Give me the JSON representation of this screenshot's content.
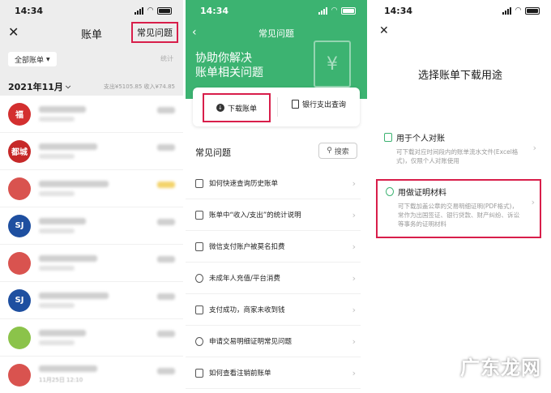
{
  "status": {
    "time": "14:34"
  },
  "bills": {
    "title": "账单",
    "faq_button": "常见问题",
    "filter_label": "全部账单",
    "stats_label": "统计",
    "month": "2021年11月",
    "totals": "支出¥5105.85  收入¥74.85",
    "last_date": "11月25日 12:10",
    "rows": [
      {
        "avatar_text": "福",
        "color": "#d32f2f"
      },
      {
        "avatar_text": "都城",
        "color": "#c62828"
      },
      {
        "avatar_text": "",
        "color": "#d9534f"
      },
      {
        "avatar_text": "SJ",
        "color": "#1e4fa0"
      },
      {
        "avatar_text": "",
        "color": "#d9534f"
      },
      {
        "avatar_text": "SJ",
        "color": "#1e4fa0"
      },
      {
        "avatar_text": "",
        "color": "#8bc34a"
      },
      {
        "avatar_text": "",
        "color": "#d9534f"
      }
    ]
  },
  "faq_page": {
    "nav_title": "常见问题",
    "headline_line1": "协助你解决",
    "headline_line2": "账单相关问题",
    "download_label": "下载账单",
    "bank_label": "银行支出查询",
    "section_title": "常见问题",
    "search_label": "搜索",
    "items": [
      "如何快速查询历史账单",
      "账单中“收入/支出”的统计说明",
      "微信支付账户被莫名扣费",
      "未成年人充值/平台消费",
      "支付成功，商家未收到钱",
      "申请交易明细证明常见问题",
      "如何查看注销前账单"
    ]
  },
  "purpose_page": {
    "title": "选择账单下载用途",
    "option1_title": "用于个人对账",
    "option1_desc": "可下载对应时间段内的账单流水文件(Excel格式)，仅限个人对账使用",
    "option2_title": "用做证明材料",
    "option2_desc": "可下载加盖公章的交易明细证明(PDF格式)，常作为出国签证、银行贷款、财产纠纷、诉讼等事务的证明材料"
  },
  "watermark": "广东龙网",
  "colors": {
    "accent_green": "#3cb371",
    "highlight_red": "#d81e4a"
  }
}
